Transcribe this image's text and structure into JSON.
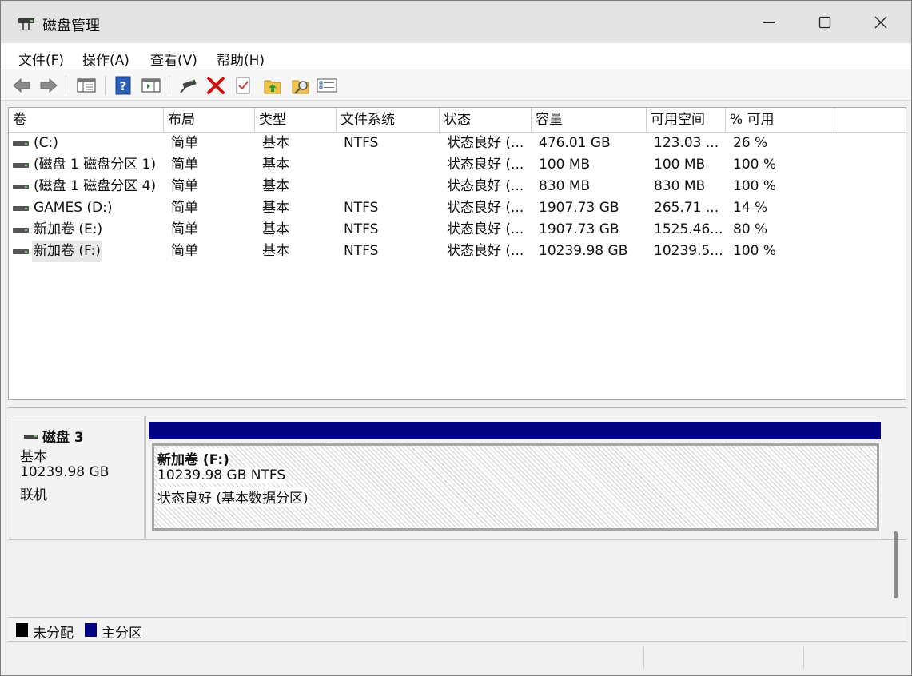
{
  "window": {
    "title": "磁盘管理"
  },
  "menu": [
    "文件(F)",
    "操作(A)",
    "查看(V)",
    "帮助(H)"
  ],
  "toolbar": [
    "back-icon",
    "forward-icon",
    "console-tree-icon",
    "help-icon",
    "action-pane-icon",
    "connect-icon",
    "delete-icon",
    "properties-icon",
    "refresh-icon",
    "search-icon",
    "settings-icon"
  ],
  "columns": [
    "卷",
    "布局",
    "类型",
    "文件系统",
    "状态",
    "容量",
    "可用空间",
    "% 可用"
  ],
  "volumes": [
    {
      "name": " (C:)",
      "layout": "简单",
      "type": "基本",
      "fs": "NTFS",
      "status": "状态良好 (...",
      "capacity": "476.01 GB",
      "free": "123.03 ...",
      "pct": "26 %"
    },
    {
      "name": "(磁盘 1 磁盘分区 1)",
      "layout": "简单",
      "type": "基本",
      "fs": "",
      "status": "状态良好 (...",
      "capacity": "100 MB",
      "free": "100 MB",
      "pct": "100 %"
    },
    {
      "name": "(磁盘 1 磁盘分区 4)",
      "layout": "简单",
      "type": "基本",
      "fs": "",
      "status": "状态良好 (...",
      "capacity": "830 MB",
      "free": "830 MB",
      "pct": "100 %"
    },
    {
      "name": "GAMES (D:)",
      "layout": "简单",
      "type": "基本",
      "fs": "NTFS",
      "status": "状态良好 (...",
      "capacity": "1907.73 GB",
      "free": "265.71 ...",
      "pct": "14 %"
    },
    {
      "name": "新加卷 (E:)",
      "layout": "简单",
      "type": "基本",
      "fs": "NTFS",
      "status": "状态良好 (...",
      "capacity": "1907.73 GB",
      "free": "1525.46...",
      "pct": "80 %"
    },
    {
      "name": "新加卷 (F:)",
      "layout": "简单",
      "type": "基本",
      "fs": "NTFS",
      "status": "状态良好 (...",
      "capacity": "10239.98 GB",
      "free": "10239.5...",
      "pct": "100 %"
    }
  ],
  "disk": {
    "name": "磁盘 3",
    "type": "基本",
    "size": "10239.98 GB",
    "state": "联机",
    "partition": {
      "name": "新加卷 (F:)",
      "size_fs": "10239.98 GB NTFS",
      "status": "状态良好 (基本数据分区)"
    }
  },
  "legend": [
    {
      "label": "未分配",
      "color": "#000000"
    },
    {
      "label": "主分区",
      "color": "#000080"
    }
  ],
  "colors": {
    "primary_partition": "#000080",
    "unallocated": "#000000"
  }
}
